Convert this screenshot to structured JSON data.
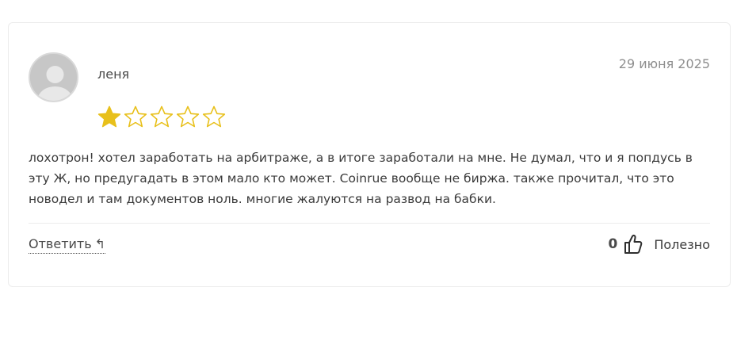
{
  "review": {
    "author": "леня",
    "date": "29 июня 2025",
    "rating": 1,
    "rating_max": 5,
    "text": "лохотрон! хотел заработать на арбитраже, а в итоге заработали на мне. Не думал, что и я попдусь в эту Ж, но предугадать в этом мало кто может. Coinrue вообще не биржа. также прочитал, что это новодел и там документов ноль. многие жалуются на развод на бабки.",
    "reply_label": "Ответить",
    "reply_icon": "↰",
    "helpful_count": "0",
    "helpful_label": "Полезно"
  },
  "colors": {
    "star": "#e8c01b",
    "border": "#ececec",
    "date": "#8e8e8e"
  },
  "icons": {
    "avatar": "default-user-avatar",
    "star_filled": "star-filled-icon",
    "star_empty": "star-outline-icon",
    "reply": "reply-arrow-icon",
    "thumb": "thumbs-up-icon"
  }
}
